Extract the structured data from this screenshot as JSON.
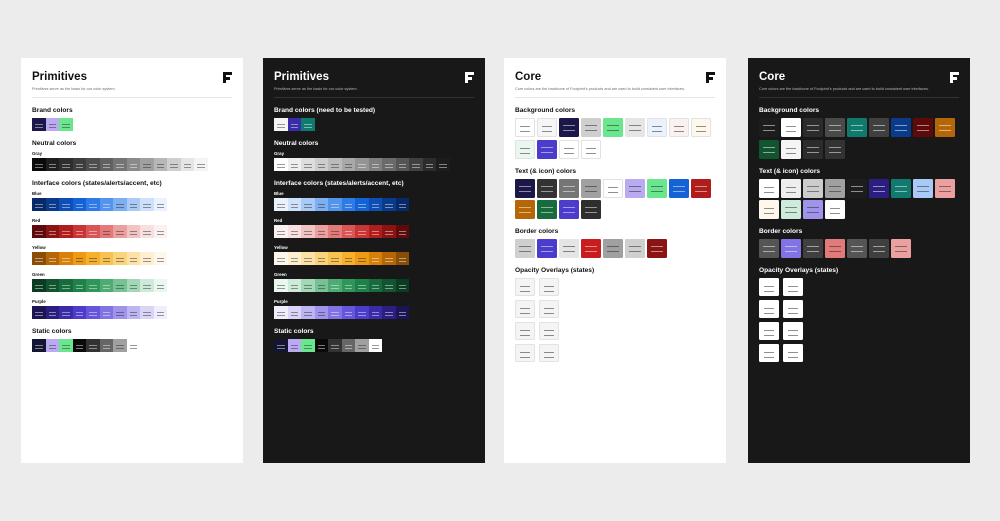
{
  "pages": [
    {
      "theme": "light",
      "title": "Primitives",
      "subtitle": "Primitives serve as the basis for our color system.",
      "sections": [
        {
          "title": "Brand colors",
          "groups": [
            {
              "label": "",
              "colors": [
                "#1b1849",
                "#b9aaf2",
                "#69e68e"
              ]
            }
          ]
        },
        {
          "title": "Neutral colors",
          "groups": [
            {
              "label": "Gray",
              "colors": [
                "#0a0a0a",
                "#1f1f1f",
                "#2e2e2e",
                "#3d3d3d",
                "#4e4e4e",
                "#616161",
                "#757575",
                "#8a8a8a",
                "#a0a0a0",
                "#b7b7b7",
                "#cfcfcf",
                "#e5e5e5",
                "#f4f4f4"
              ]
            }
          ]
        },
        {
          "title": "Interface colors (states/alerts/accent, etc)",
          "groups": [
            {
              "label": "Blue",
              "colors": [
                "#072a66",
                "#0a3a8a",
                "#0e4fb5",
                "#1463d6",
                "#2f7be6",
                "#5395ec",
                "#7eb0f1",
                "#a9caf6",
                "#cfe0fa",
                "#eaf2fd"
              ]
            },
            {
              "label": "Red",
              "colors": [
                "#5e0a0a",
                "#8a1414",
                "#b01d1d",
                "#c93434",
                "#d95656",
                "#e27a7a",
                "#eb9f9f",
                "#f2c3c3",
                "#f8e0e0",
                "#fcf1f1"
              ]
            },
            {
              "label": "Yellow",
              "colors": [
                "#8a4d05",
                "#b56707",
                "#d9800a",
                "#ee9a12",
                "#f5b02e",
                "#f8c252",
                "#fad37d",
                "#fce2a8",
                "#fdefcf",
                "#fef8ec"
              ]
            },
            {
              "label": "Green",
              "colors": [
                "#0c3b24",
                "#11542f",
                "#176b3c",
                "#1f8049",
                "#2e9659",
                "#4dab73",
                "#77c294",
                "#a3d8b6",
                "#cdeada",
                "#eaf7ef"
              ]
            },
            {
              "label": "Purple",
              "colors": [
                "#1b1554",
                "#2a1f80",
                "#3a2ba8",
                "#4c3ccb",
                "#6556db",
                "#8173e3",
                "#9f94ea",
                "#bdb5f1",
                "#dad5f7",
                "#f0eefc"
              ]
            }
          ]
        },
        {
          "title": "Static colors",
          "groups": [
            {
              "label": "",
              "colors": [
                "#141433",
                "#b9aaf2",
                "#69e68e",
                "#0a0a0a",
                "#333333",
                "#666666",
                "#a0a0a0",
                "#ffffff"
              ]
            }
          ]
        }
      ]
    },
    {
      "theme": "dark",
      "title": "Primitives",
      "subtitle": "Primitives serve as the basis for our color system.",
      "sections": [
        {
          "title": "Brand colors (need to be tested)",
          "groups": [
            {
              "label": "",
              "colors": [
                "#f5f5f5",
                "#3a2ba8",
                "#0f7a6d"
              ]
            }
          ]
        },
        {
          "title": "Neutral colors",
          "groups": [
            {
              "label": "Gray",
              "colors": [
                "#ffffff",
                "#eeeeee",
                "#dddddd",
                "#cccccc",
                "#bbbbbb",
                "#a8a8a8",
                "#949494",
                "#7f7f7f",
                "#6a6a6a",
                "#555555",
                "#404040",
                "#2c2c2c",
                "#1d1d1d"
              ]
            }
          ]
        },
        {
          "title": "Interface colors (states/alerts/accent, etc)",
          "groups": [
            {
              "label": "Blue",
              "colors": [
                "#eaf2fd",
                "#cfe0fa",
                "#a9caf6",
                "#7eb0f1",
                "#5395ec",
                "#2f7be6",
                "#1463d6",
                "#0e4fb5",
                "#0a3a8a",
                "#072a66"
              ]
            },
            {
              "label": "Red",
              "colors": [
                "#fcf1f1",
                "#f8e0e0",
                "#f2c3c3",
                "#eb9f9f",
                "#e27a7a",
                "#d95656",
                "#c93434",
                "#b01d1d",
                "#8a1414",
                "#5e0a0a"
              ]
            },
            {
              "label": "Yellow",
              "colors": [
                "#fef8ec",
                "#fdefcf",
                "#fce2a8",
                "#fad37d",
                "#f8c252",
                "#f5b02e",
                "#ee9a12",
                "#d9800a",
                "#b56707",
                "#8a4d05"
              ]
            },
            {
              "label": "Green",
              "colors": [
                "#eaf7ef",
                "#cdeada",
                "#a3d8b6",
                "#77c294",
                "#4dab73",
                "#2e9659",
                "#1f8049",
                "#176b3c",
                "#11542f",
                "#0c3b24"
              ]
            },
            {
              "label": "Purple",
              "colors": [
                "#f0eefc",
                "#dad5f7",
                "#bdb5f1",
                "#9f94ea",
                "#8173e3",
                "#6556db",
                "#4c3ccb",
                "#3a2ba8",
                "#2a1f80",
                "#1b1554"
              ]
            }
          ]
        },
        {
          "title": "Static colors",
          "groups": [
            {
              "label": "",
              "colors": [
                "#141433",
                "#b9aaf2",
                "#69e68e",
                "#0a0a0a",
                "#333333",
                "#666666",
                "#a0a0a0",
                "#ffffff"
              ]
            }
          ]
        }
      ]
    },
    {
      "theme": "light",
      "title": "Core",
      "subtitle": "Core colors are the backbone of Footprint's products and are used to build consistent user interfaces.",
      "sections": [
        {
          "title": "Background colors",
          "tiles": [
            "#ffffff",
            "#f6f6f6",
            "#1b1849",
            "#cfcfcf",
            "#69e68e",
            "#e5e5e5",
            "#eaf2fd",
            "#fcf1f1",
            "#fef8ec",
            "#eaf7ef",
            "#4c3ccb",
            "#ffffff",
            "#ffffff"
          ]
        },
        {
          "title": "Text (& icon) colors",
          "tiles": [
            "#1b1849",
            "#333333",
            "#757575",
            "#a0a0a0",
            "#ffffff",
            "#b9aaf2",
            "#69e68e",
            "#1463d6",
            "#b01d1d",
            "#b56707",
            "#176b3c",
            "#4c3ccb",
            "#2e2e2e"
          ]
        },
        {
          "title": "Border colors",
          "tiles": [
            "#cfcfcf",
            "#4c3ccb",
            "#e5e5e5",
            "#c91d1d",
            "#a0a0a0",
            "#cfcfcf",
            "#8a1414"
          ]
        },
        {
          "title": "Opacity Overlays (states)",
          "tiles": [
            "#f4f4f4",
            "#f4f4f4",
            "#f4f4f4",
            "#f4f4f4",
            "#f4f4f4",
            "#f4f4f4",
            "#f4f4f4",
            "#f4f4f4"
          ],
          "overlay": true
        }
      ]
    },
    {
      "theme": "dark",
      "title": "Core",
      "subtitle": "Core colors are the backbone of Footprint's products and are used to build consistent user interfaces.",
      "sections": [
        {
          "title": "Background colors",
          "tiles": [
            "#1d1d1d",
            "#ffffff",
            "#2c2c2c",
            "#4a4a4a",
            "#0f7a6d",
            "#404040",
            "#0a3a8a",
            "#5e0a0a",
            "#b56707",
            "#11542f",
            "#f5f5f5",
            "#2c2c2c",
            "#333333"
          ]
        },
        {
          "title": "Text (& icon) colors",
          "tiles": [
            "#ffffff",
            "#eeeeee",
            "#cccccc",
            "#a0a0a0",
            "#1d1d1d",
            "#2a1f80",
            "#0f7a6d",
            "#a9caf6",
            "#eb9f9f",
            "#fef8ec",
            "#cdeada",
            "#9f94ea",
            "#ffffff"
          ]
        },
        {
          "title": "Border colors",
          "tiles": [
            "#555555",
            "#8173e3",
            "#404040",
            "#e27a7a",
            "#555555",
            "#404040",
            "#eb9f9f"
          ]
        },
        {
          "title": "Opacity Overlays (states)",
          "tiles": [
            "#ffffff",
            "#ffffff",
            "#ffffff",
            "#ffffff",
            "#ffffff",
            "#ffffff",
            "#ffffff",
            "#ffffff"
          ],
          "overlay": true
        }
      ]
    }
  ]
}
